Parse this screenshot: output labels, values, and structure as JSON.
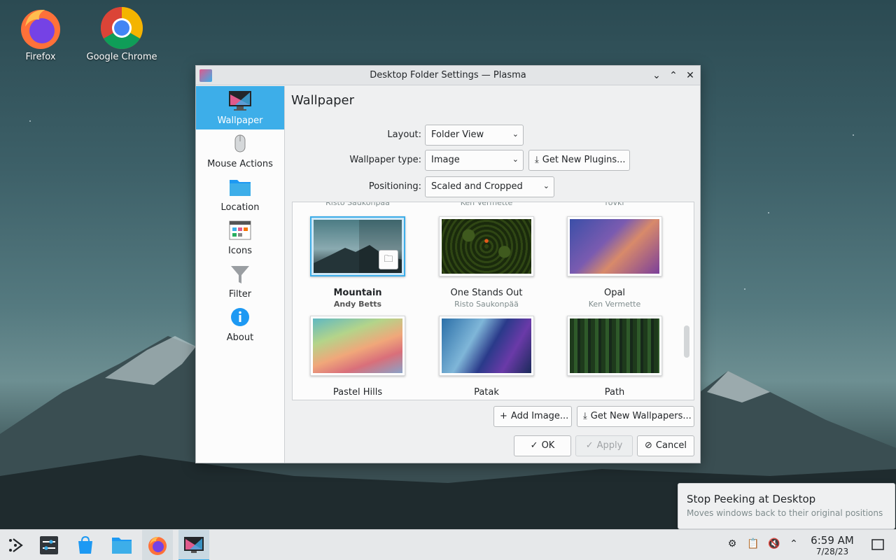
{
  "desktop": {
    "icons": [
      {
        "label": "Firefox"
      },
      {
        "label": "Google Chrome"
      }
    ]
  },
  "window": {
    "title": "Desktop Folder Settings — Plasma",
    "sidebar": [
      {
        "label": "Wallpaper",
        "icon": "monitor-icon",
        "active": true
      },
      {
        "label": "Mouse Actions",
        "icon": "mouse-icon"
      },
      {
        "label": "Location",
        "icon": "folder-icon"
      },
      {
        "label": "Icons",
        "icon": "icons-icon"
      },
      {
        "label": "Filter",
        "icon": "filter-icon"
      },
      {
        "label": "About",
        "icon": "info-icon"
      }
    ],
    "page_title": "Wallpaper",
    "form": {
      "layout_label": "Layout:",
      "layout_value": "Folder View",
      "type_label": "Wallpaper type:",
      "type_value": "Image",
      "get_plugins": "Get New Plugins...",
      "positioning_label": "Positioning:",
      "positioning_value": "Scaled and Cropped"
    },
    "partial_authors": [
      "Risto Saukonpää",
      "Ken Vermette",
      "rovki"
    ],
    "wallpapers": [
      {
        "name": "Mountain",
        "author": "Andy Betts",
        "selected": true
      },
      {
        "name": "One Stands Out",
        "author": "Risto Saukonpää"
      },
      {
        "name": "Opal",
        "author": "Ken Vermette"
      },
      {
        "name": "Pastel Hills",
        "author": ""
      },
      {
        "name": "Patak",
        "author": ""
      },
      {
        "name": "Path",
        "author": ""
      }
    ],
    "buttons": {
      "add_image": "Add Image...",
      "get_wallpapers": "Get New Wallpapers...",
      "ok": "OK",
      "apply": "Apply",
      "cancel": "Cancel"
    }
  },
  "notification": {
    "title": "Stop Peeking at Desktop",
    "body": "Moves windows back to their original positions"
  },
  "taskbar": {
    "time": "6:59 AM",
    "date": "7/28/23"
  },
  "colors": {
    "accent": "#3daee9",
    "window_bg": "#eff0f1"
  }
}
